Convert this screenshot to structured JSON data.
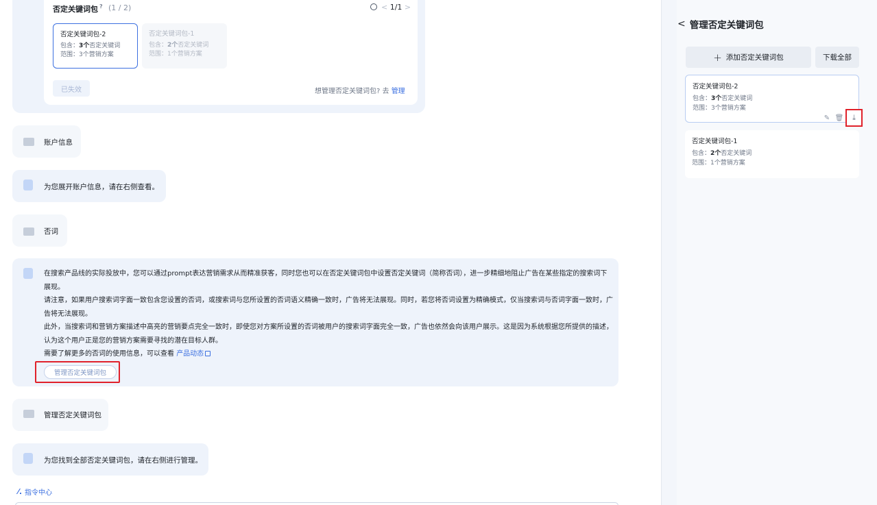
{
  "top_card": {
    "title": "否定关键词包",
    "help_mark": "?",
    "count": "(1 / 2)",
    "pager": "1/1",
    "pager_prev": "<",
    "pager_next": ">",
    "packages": [
      {
        "name": "否定关键词包-2",
        "include_prefix": "包含：",
        "include_count": "3个",
        "include_suffix": "否定关键词",
        "scope": "范围：3个营销方案"
      },
      {
        "name": "否定关键词包-1",
        "include_prefix": "包含：",
        "include_count": "2个",
        "include_suffix": "否定关键词",
        "scope": "范围：1个营销方案"
      }
    ],
    "expired_label": "已失效",
    "manage_hint": "想管理否定关键词包? 去",
    "manage_link": "管理"
  },
  "chat": {
    "account_info": "账户信息",
    "expand_account": "为您展开账户信息，请在右侧查看。",
    "neg_word": "否词",
    "long_paragraphs": [
      "在搜索产品线的实际投放中，您可以通过prompt表达营销需求从而精准获客，同时您也可以在否定关键词包中设置否定关键词（简称否词），进一步精细地阻止广告在某些指定的搜索词下展现。",
      "请注意，如果用户搜索词字面一致包含您设置的否词，或搜索词与您所设置的否词语义精确一致时，广告将无法展现。同时，若您将否词设置为精确模式，仅当搜索词与否词字面一致时，广告将无法展现。",
      "此外，当搜索词和营销方案描述中高亮的营销要点完全一致时，即使您对方案所设置的否词被用户的搜索词字面完全一致，广告也依然会向该用户展示。这是因为系统根据您所提供的描述，认为这个用户正是您的营销方案需要寻找的潜在目标人群。"
    ],
    "more_info_prefix": "需要了解更多的否词的使用信息，可以查看",
    "more_info_link": "产品动态",
    "manage_pkg_button": "管理否定关键词包",
    "manage_pkg_msg": "管理否定关键词包",
    "found_all": "为您找到全部否定关键词包，请在右侧进行管理。",
    "command_center": "指令中心"
  },
  "side_panel": {
    "back": "<",
    "title": "管理否定关键词包",
    "add_button": "添加否定关键词包",
    "download_all": "下载全部",
    "packages": [
      {
        "name": "否定关键词包-2",
        "include_prefix": "包含：",
        "include_count": "3个",
        "include_suffix": "否定关键词",
        "scope": "范围：3个营销方案"
      },
      {
        "name": "否定关键词包-1",
        "include_prefix": "包含：",
        "include_count": "2个",
        "include_suffix": "否定关键词",
        "scope": "范围：1个营销方案"
      }
    ]
  },
  "colors": {
    "accent": "#3b6fe0",
    "highlight_box": "#e0212a",
    "bubble_bg": "#eef3fb"
  }
}
